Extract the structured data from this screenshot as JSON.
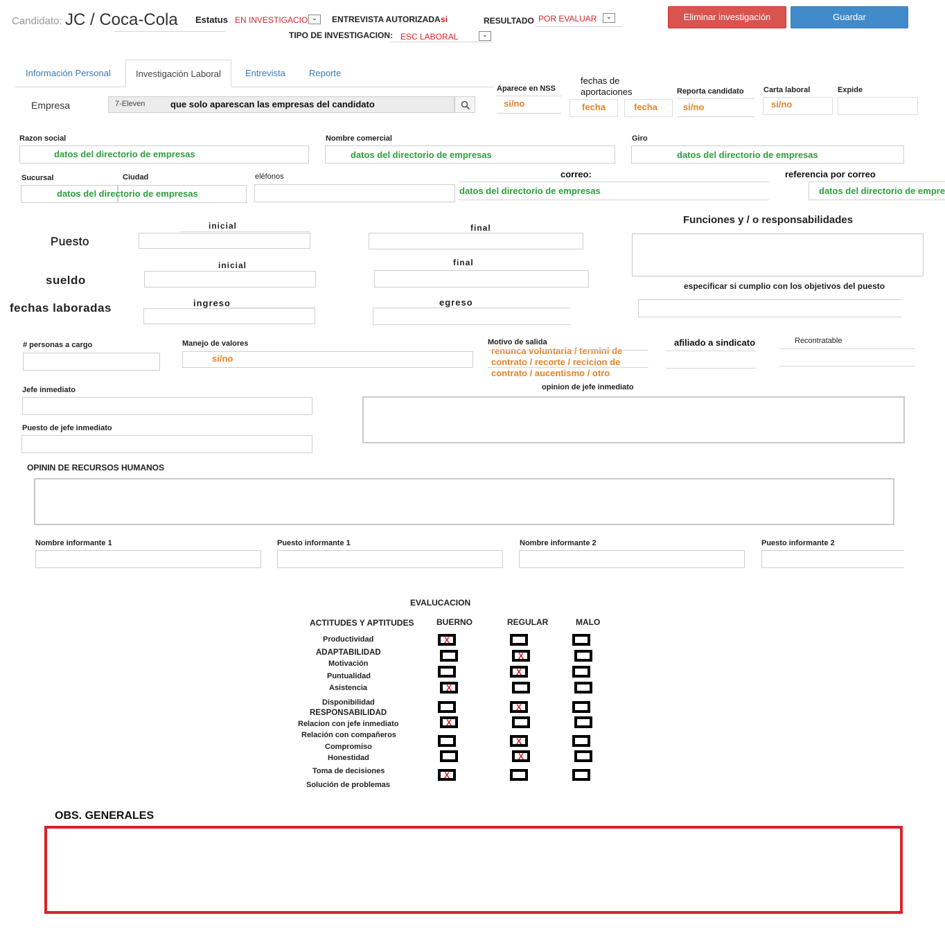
{
  "header": {
    "candidate_label": "Candidato:",
    "candidate_name": "JC / Coca-Cola",
    "status_label": "Estatus",
    "status_value": "EN INVESTIGACION",
    "interview_label": "ENTREVISTA AUTORIZADA",
    "interview_value": "si",
    "result_label": "RESULTADO",
    "result_value": "POR EVALUAR",
    "investigation_type_label": "TIPO DE INVESTIGACION:",
    "investigation_type_value": "ESC LABORAL",
    "delete_button": "Eliminar investigación",
    "save_button": "Guardar"
  },
  "tabs": [
    "Información Personal",
    "Investigación Laboral",
    "Entrevista",
    "Reporte"
  ],
  "company_row": {
    "empresa_label": "Empresa",
    "empresa_value": "7-Eleven",
    "empresa_note": "que solo aparescan las empresas del candidato",
    "nss_label": "Aparece en NSS",
    "nss_value": "si/no",
    "aportaciones_label": "fechas de aportaciones",
    "fecha1": "fecha",
    "fecha2": "fecha",
    "reporta_label": "Reporta candidato",
    "reporta_value": "si/no",
    "carta_label": "Carta laboral",
    "carta_value": "si/no",
    "expide_label": "Expide"
  },
  "directory": {
    "razon_label": "Razon social",
    "nombre_comercial_label": "Nombre comercial",
    "giro_label": "Giro",
    "sucursal_label": "Sucursal",
    "ciudad_label": "Ciudad",
    "telefonos_label": "eléfonos",
    "correo_label": "correo:",
    "referencia_label": "referencia por correo",
    "placeholder": "datos del directorio de empresas",
    "placeholder_cut": "datos del directorio de empre"
  },
  "position": {
    "puesto": "Puesto",
    "sueldo": "sueldo",
    "fechas": "fechas laboradas",
    "inicial": "inicial",
    "final": "final",
    "ingreso": "ingreso",
    "egreso": "egreso",
    "funciones": "Funciones  y / o responsabilidades",
    "objetivos": "especificar si cumplio con los objetivos del puesto"
  },
  "details": {
    "personas_label": "# personas a cargo",
    "valores_label": "Manejo de valores",
    "valores_value": "si/no",
    "motivo_label": "Motivo de salida",
    "motivo_value": "renunca voluntaria / termini de contrato / recorte / recicion de contrato / aucentismo / otro",
    "sindicato_label": "afiliado a sindicato",
    "recontratable_label": "Recontratable",
    "jefe_label": "Jefe inmediato",
    "puesto_jefe_label": "Puesto de jefe inmediato",
    "opinion_jefe_label": "opinion de jefe inmediato",
    "opinion_rh_label": "OPININ DE RECURSOS HUMANOS",
    "informante1_label": "Nombre informante 1",
    "puesto_inf1_label": "Puesto informante 1",
    "informante2_label": "Nombre informante 2",
    "puesto_inf2_label": "Puesto informante 2"
  },
  "evaluation": {
    "title": "EVALUCACION",
    "col_main": "ACTITUDES Y APTITUDES",
    "col_good": "BUERNO",
    "col_regular": "REGULAR",
    "col_bad": "MALO",
    "rows": [
      {
        "label": "Productividad",
        "mark": "good"
      },
      {
        "label": "ADAPTABILIDAD",
        "mark": "regular"
      },
      {
        "label": "Motivación",
        "mark": "regular"
      },
      {
        "label": "Puntualidad",
        "mark": "none"
      },
      {
        "label": "Asistencia",
        "mark": "good"
      },
      {
        "label": "Disponibilidad",
        "mark": "regular"
      },
      {
        "label": "RESPONSABILIDAD",
        "mark": "none"
      },
      {
        "label": "Relacion con jefe inmediato",
        "mark": "good"
      },
      {
        "label": "Relación con compañeros",
        "mark": "none"
      },
      {
        "label": "Compromiso",
        "mark": "regular"
      },
      {
        "label": "Honestidad",
        "mark": "regular"
      },
      {
        "label": "Toma de decisiones",
        "mark": "good"
      },
      {
        "label": "Solución de problemas",
        "mark": "none"
      }
    ],
    "mark_symbol": "X"
  },
  "obs": {
    "label": "OBS. GENERALES"
  },
  "colors": {
    "accent_red": "#d9534f",
    "accent_blue": "#428bca",
    "green_text": "#2e9e3e",
    "orange_text": "#e5842a",
    "status_red": "#d8232a"
  }
}
